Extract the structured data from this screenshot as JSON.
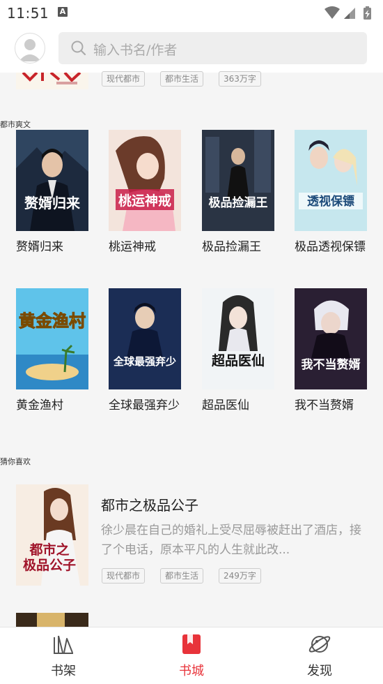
{
  "status_bar": {
    "time": "11:51",
    "notif_letter": "A"
  },
  "search": {
    "placeholder": "输入书名/作者"
  },
  "partial_book": {
    "tags": [
      "现代都市",
      "都市生活",
      "363万字"
    ]
  },
  "section_dushi": {
    "title": "都市爽文",
    "books": [
      {
        "name": "赘婿归来",
        "cover_text": "赘婿归来",
        "cover_bg": "#1d2a3e"
      },
      {
        "name": "桃运神戒",
        "cover_text": "桃运神戒",
        "cover_bg": "#f2d9cf"
      },
      {
        "name": "极品捡漏王",
        "cover_text": "极品捡漏王",
        "cover_bg": "#2b3545"
      },
      {
        "name": "极品透视保镖",
        "cover_text": "透视保镖",
        "cover_bg": "#bfe3ea"
      },
      {
        "name": "黄金渔村",
        "cover_text": "黄金渔村",
        "cover_bg": "#4fb6e0"
      },
      {
        "name": "全球最强弃少",
        "cover_text": "全球最强弃少",
        "cover_bg": "#1a2c52"
      },
      {
        "name": "超品医仙",
        "cover_text": "超品医仙",
        "cover_bg": "#eef2f4"
      },
      {
        "name": "我不当赘婿",
        "cover_text": "我不当赘婿",
        "cover_bg": "#2a1f33"
      }
    ]
  },
  "section_guess": {
    "title": "猜你喜欢",
    "items": [
      {
        "title": "都市之极品公子",
        "desc": "徐少晨在自己的婚礼上受尽屈辱被赶出了酒店，接了个电话，原本平凡的人生就此改...",
        "tags": [
          "现代都市",
          "都市生活",
          "249万字"
        ],
        "cover_text": "都市之极品公子"
      }
    ]
  },
  "bottom_nav": [
    {
      "label": "书架",
      "icon": "bookshelf-icon"
    },
    {
      "label": "书城",
      "icon": "bookstore-icon"
    },
    {
      "label": "发现",
      "icon": "discover-icon"
    }
  ],
  "colors": {
    "accent": "#e8333a"
  }
}
